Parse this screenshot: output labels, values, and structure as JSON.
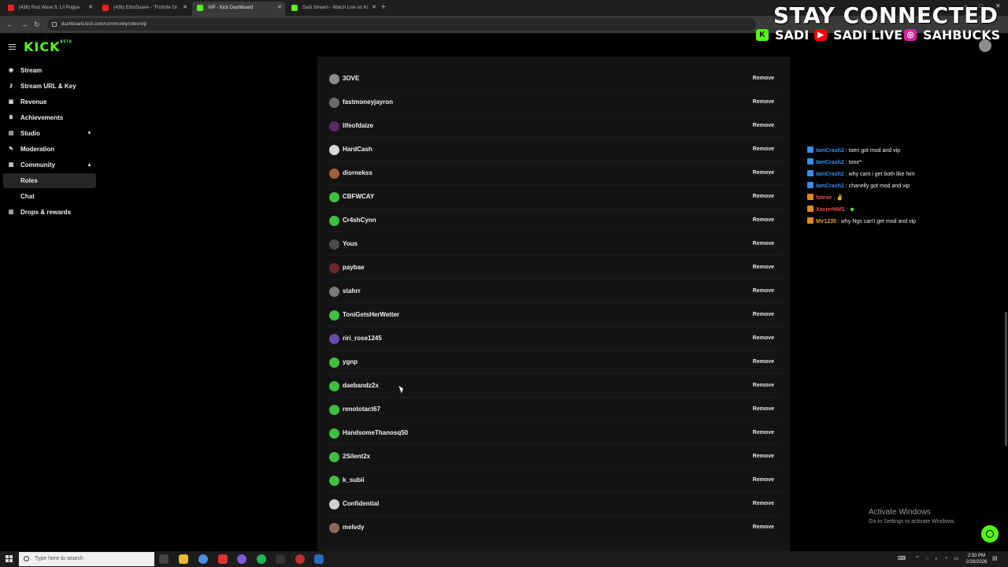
{
  "browser": {
    "tabs": [
      {
        "title": "(436) Rod Wave ft. Lil Poppa",
        "favicon": "youtube"
      },
      {
        "title": "(436) EthoSuave - \"Fortnite Gr",
        "favicon": "youtube"
      },
      {
        "title": "VIP - Kick Dashboard",
        "favicon": "kick"
      },
      {
        "title": "Sadi Stream - Watch Live on Ki",
        "favicon": "kick"
      }
    ],
    "url": "dashboard.kick.com/community/roles/vip"
  },
  "app": {
    "logo": "KICK",
    "logo_tm": "BETA"
  },
  "sidebar": {
    "items": [
      {
        "label": "Stream",
        "icon": "broadcast-icon"
      },
      {
        "label": "Stream URL & Key",
        "icon": "key-icon"
      },
      {
        "label": "Revenue",
        "icon": "dollar-icon"
      },
      {
        "label": "Achievements",
        "icon": "trophy-icon"
      },
      {
        "label": "Studio",
        "icon": "studio-icon"
      },
      {
        "label": "Moderation",
        "icon": "shield-icon"
      },
      {
        "label": "Community",
        "icon": "people-icon"
      },
      {
        "label": "Roles",
        "sub": true
      },
      {
        "label": "Chat",
        "sub": true
      },
      {
        "label": "Drops & rewards",
        "icon": "gift-icon"
      }
    ]
  },
  "vip_list": {
    "remove_label": "Remove",
    "users": [
      {
        "name": "3OVE",
        "avatar": "#8a8a8a"
      },
      {
        "name": "fastmoneyjayron",
        "avatar": "#6a6a6a"
      },
      {
        "name": "lifeofdaize",
        "avatar": "#5a2a6a"
      },
      {
        "name": "HardCash",
        "avatar": "#d8d8d8"
      },
      {
        "name": "diornekss",
        "avatar": "#a0603a"
      },
      {
        "name": "CBFWCAY",
        "avatar": "#3fbf3f"
      },
      {
        "name": "Cr4shCynn",
        "avatar": "#3fbf3f"
      },
      {
        "name": "Yous",
        "avatar": "#4a4a4a"
      },
      {
        "name": "paybae",
        "avatar": "#6a2a2a"
      },
      {
        "name": "stahrr",
        "avatar": "#7a7a7a"
      },
      {
        "name": "ToniGetsHerWetter",
        "avatar": "#3fbf3f"
      },
      {
        "name": "riri_rose1245",
        "avatar": "#6a4ab0"
      },
      {
        "name": "ygnp",
        "avatar": "#3fbf3f"
      },
      {
        "name": "daebandz2x",
        "avatar": "#3fbf3f"
      },
      {
        "name": "renototact67",
        "avatar": "#3fbf3f"
      },
      {
        "name": "HandsomeThanosq50",
        "avatar": "#3fbf3f"
      },
      {
        "name": "2Silent2x",
        "avatar": "#3fbf3f"
      },
      {
        "name": "k_subii",
        "avatar": "#3fbf3f"
      },
      {
        "name": "Confidential",
        "avatar": "#d0d0d0"
      },
      {
        "name": "melvdy",
        "avatar": "#8a6a5a"
      }
    ]
  },
  "overlay": {
    "title": "STAY CONNECTED",
    "kick_name": "SADI",
    "youtube_name": "SADI LIVE",
    "instagram_name": "SAHBUCKS"
  },
  "chat": {
    "messages": [
      {
        "user": "IamCrash2",
        "text": ": toen got mod and vip",
        "color": "#3a8ee6"
      },
      {
        "user": "IamCrash2",
        "text": ": tone*",
        "color": "#3a8ee6"
      },
      {
        "user": "IamCrash2",
        "text": ": why cant i get both like him",
        "color": "#3a8ee6"
      },
      {
        "user": "IamCrash2",
        "text": ": chanelly got mod and vip",
        "color": "#3a8ee6"
      },
      {
        "user": "fateae",
        "text": ": ✌",
        "color": "#e24a4a"
      },
      {
        "user": "XavierNMS",
        "text": ": ☻",
        "color": "#e24a4a"
      },
      {
        "user": "Mir1230",
        "text": ": why Ngs can't get mod and vip",
        "color": "#e0a020"
      }
    ]
  },
  "windows": {
    "activate_title": "Activate Windows",
    "activate_sub": "Go to Settings to activate Windows."
  },
  "taskbar": {
    "search_placeholder": "Type here to search",
    "time": "2:50 PM",
    "date": "2/28/2026"
  }
}
